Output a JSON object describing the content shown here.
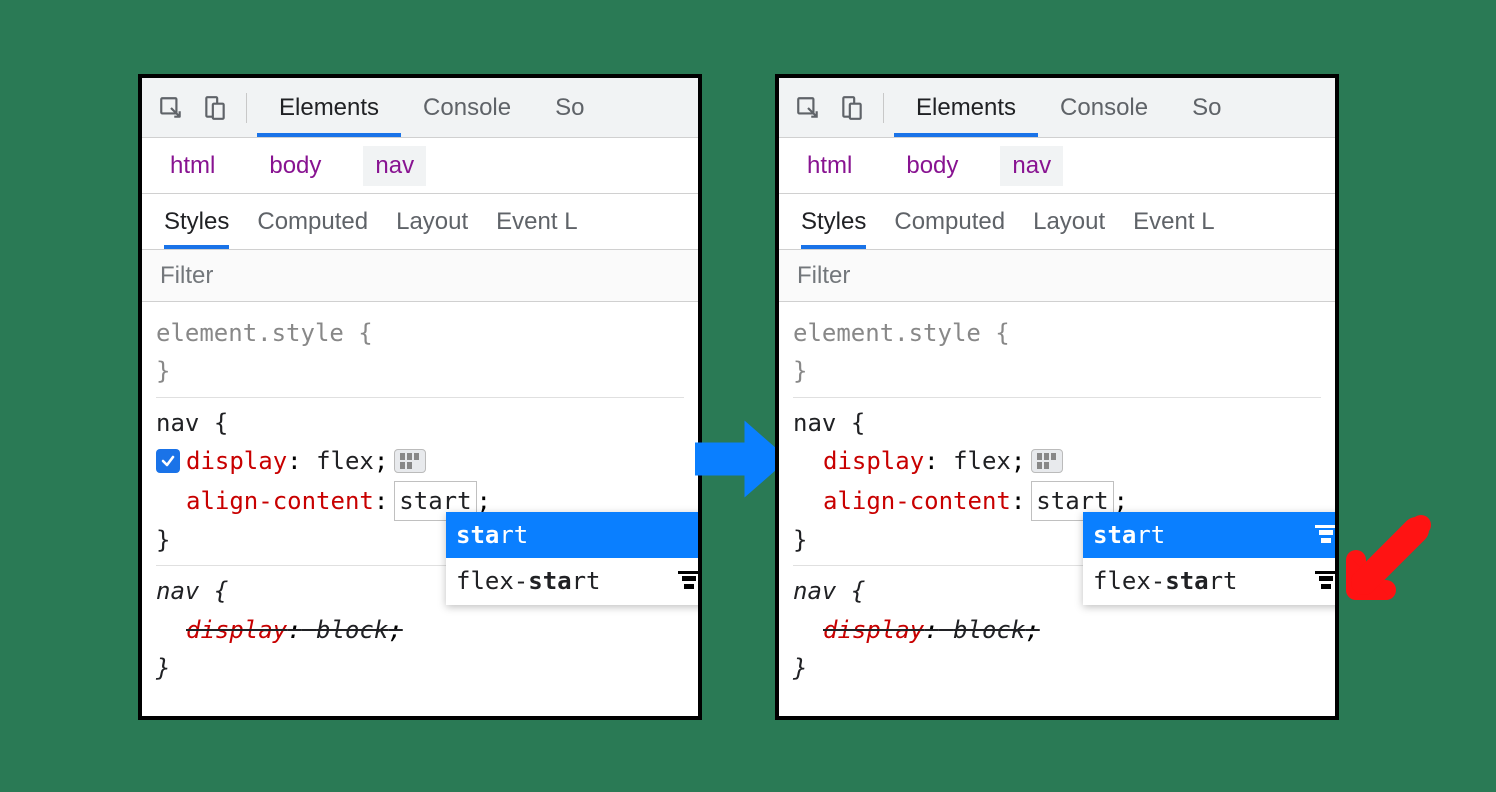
{
  "toolbar": {
    "tabs": [
      "Elements",
      "Console",
      "So"
    ],
    "active": 0
  },
  "breadcrumbs": [
    "html",
    "body",
    "nav"
  ],
  "subtabs": [
    "Styles",
    "Computed",
    "Layout",
    "Event L"
  ],
  "filter_placeholder": "Filter",
  "rules": {
    "inline": {
      "selector": "element.style",
      "open": "{",
      "close": "}"
    },
    "nav1": {
      "selector": "nav",
      "open": "{",
      "close": "}",
      "props": [
        {
          "name": "display",
          "value": "flex",
          "checked": true,
          "has_flex_badge": true
        },
        {
          "name": "align-content",
          "value_input": "start",
          "suffix": ";"
        }
      ]
    },
    "nav2": {
      "selector": "nav",
      "open": "{",
      "close": "}",
      "prop": {
        "name": "display",
        "value": "block",
        "overridden": true
      }
    }
  },
  "suggestions": {
    "items": [
      {
        "prefix": "sta",
        "rest": "rt",
        "selected": true,
        "has_icon_left": false,
        "has_icon_right": true
      },
      {
        "pre": "flex-",
        "bold": "sta",
        "rest": "rt",
        "selected": false,
        "has_icon": true
      }
    ],
    "labels": {
      "start": "start",
      "flex_start": "flex-start"
    }
  },
  "colors": {
    "accent": "#1a73e8",
    "selection": "#0a7fff",
    "prop": "#c80000",
    "crumb": "#881391"
  }
}
